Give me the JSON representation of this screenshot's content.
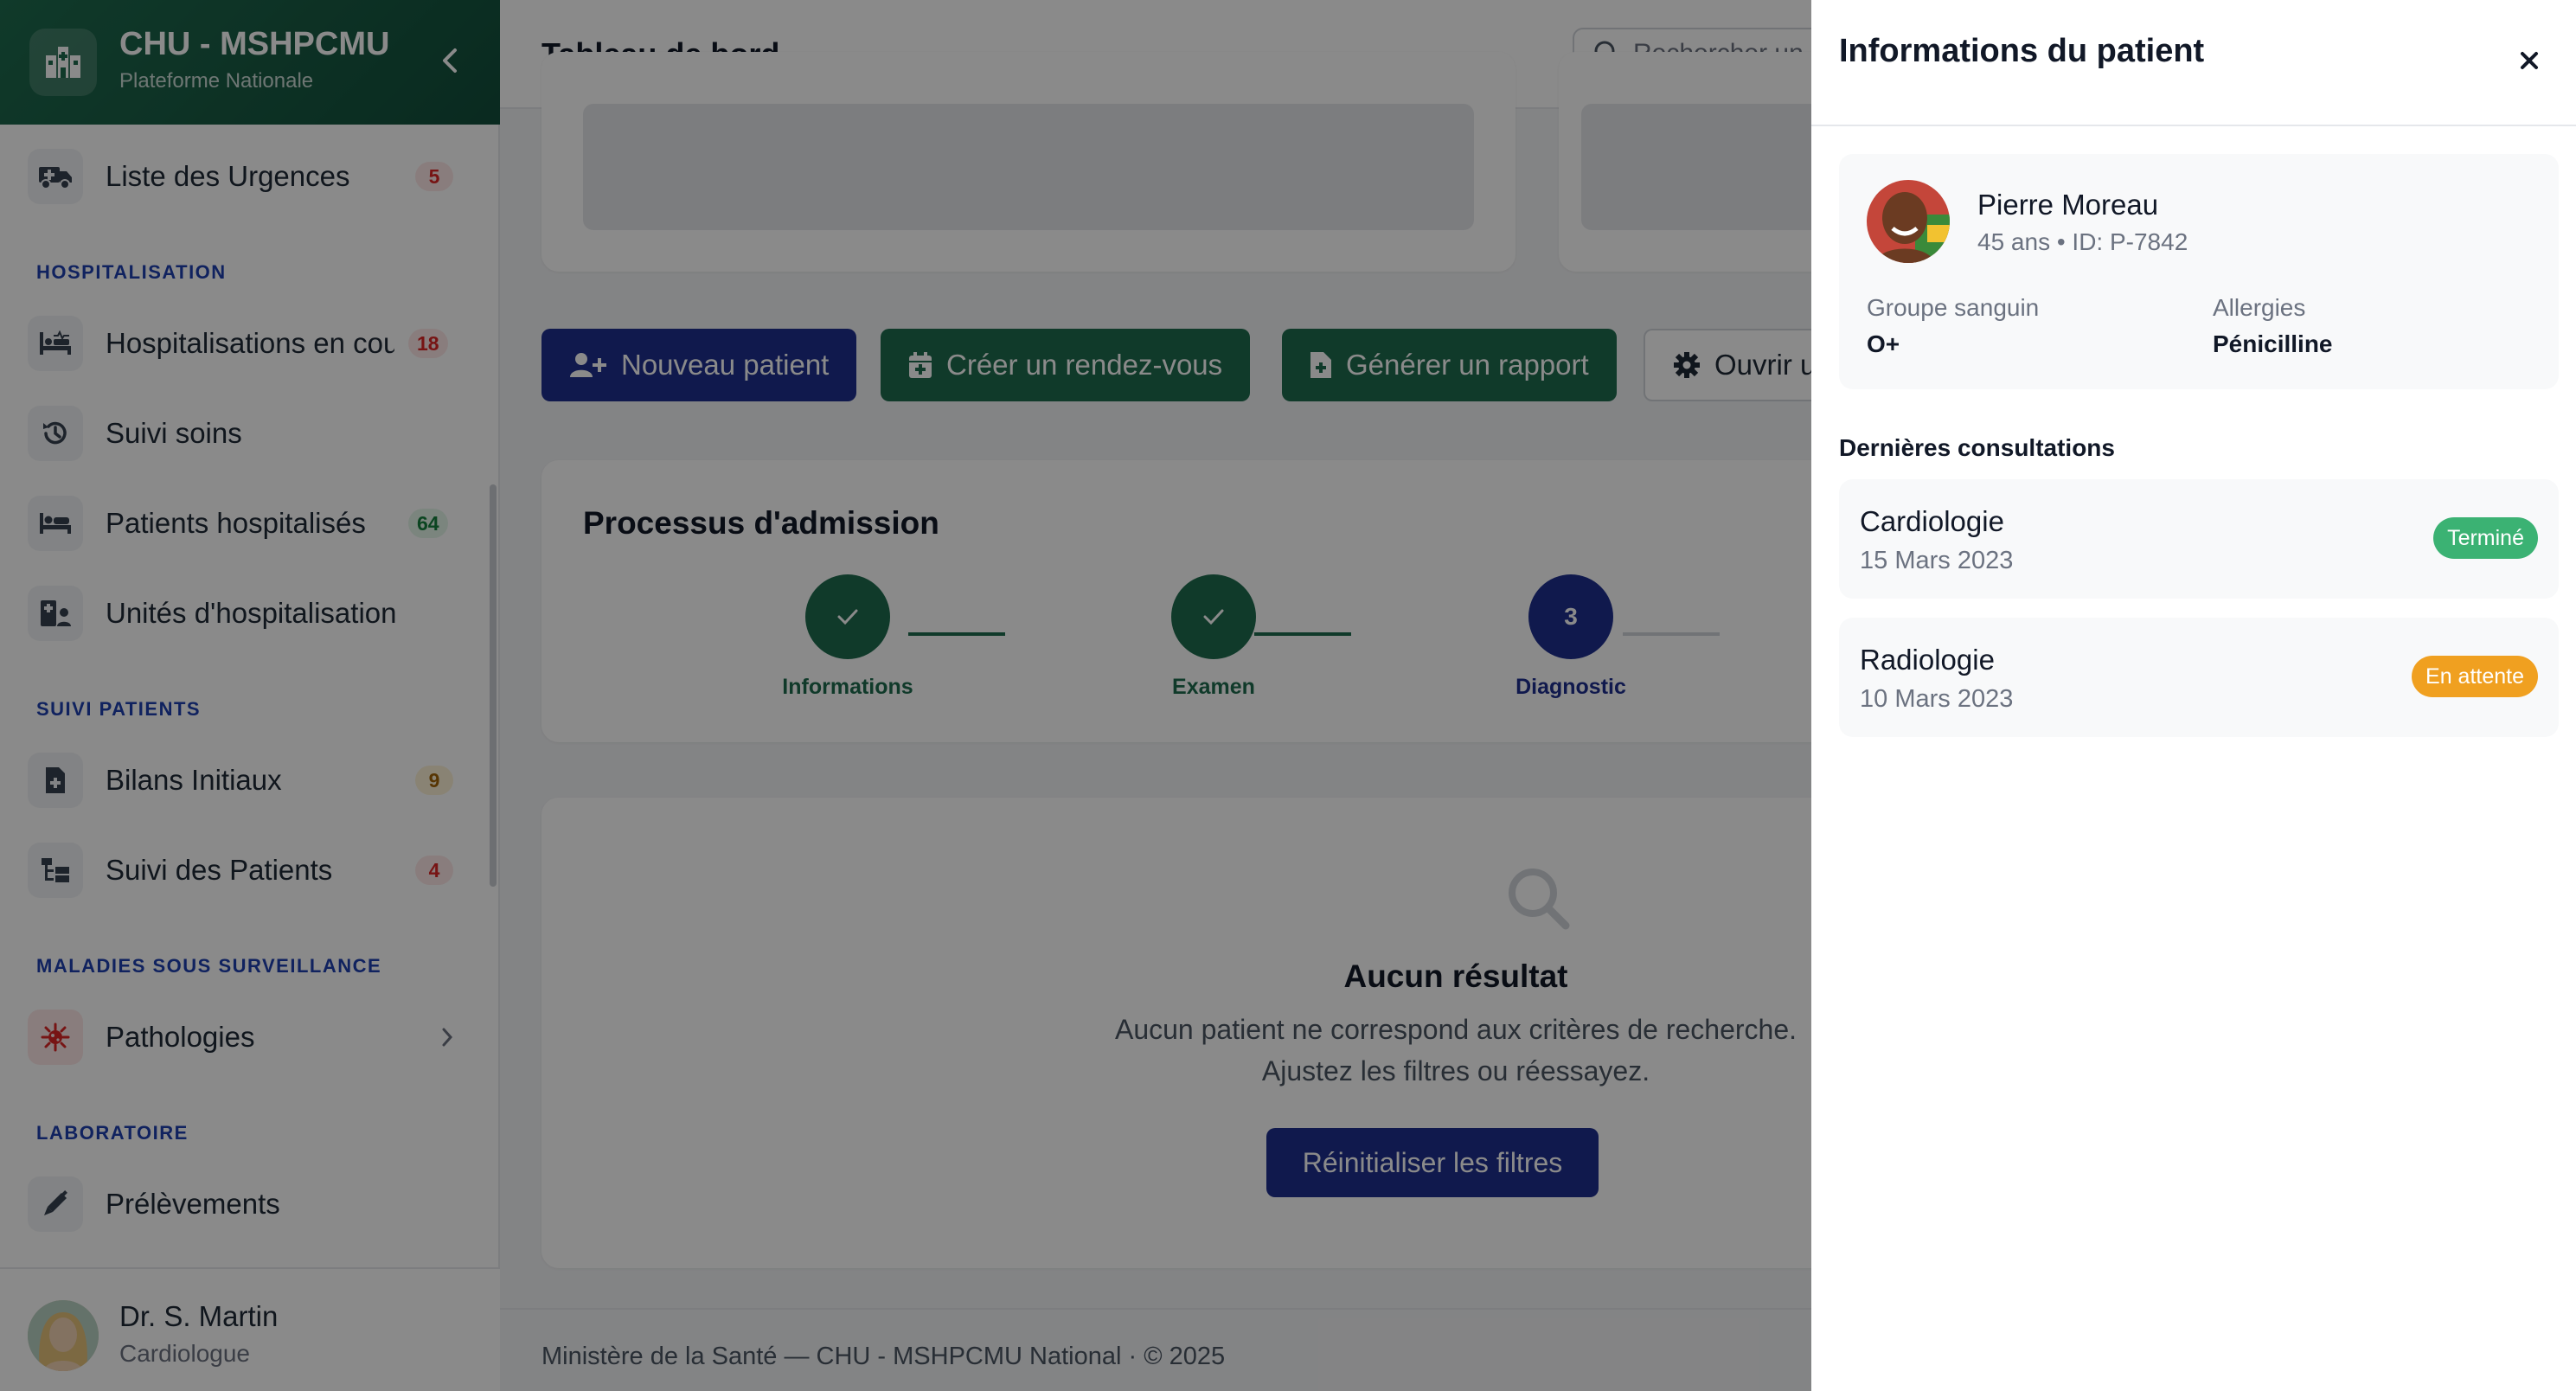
{
  "colors": {
    "brand": "#1e6b4e",
    "primary_blue": "#1e2f8f",
    "accent_green": "#1e6b4e",
    "danger": "#dc2626",
    "success": "#3bb273",
    "warning": "#f0a020"
  },
  "sidebar": {
    "brand_title": "CHU - MSHPCMU",
    "brand_subtitle": "Plateforme Nationale",
    "items": [
      {
        "label": "Liste des Urgences",
        "icon": "ambulance-icon",
        "badge": "5"
      },
      {
        "label": "Hospitalisations en cours",
        "icon": "bed-pulse-icon",
        "badge": "18"
      },
      {
        "label": "Suivi soins",
        "icon": "history-icon",
        "badge": null
      },
      {
        "label": "Patients hospitalisés",
        "icon": "bed-icon",
        "badge": "64"
      },
      {
        "label": "Unités d'hospitalisation",
        "icon": "hospital-user-icon",
        "badge": null
      },
      {
        "label": "Bilans Initiaux",
        "icon": "file-medical-icon",
        "badge": "9"
      },
      {
        "label": "Suivi des Patients",
        "icon": "tree-list-icon",
        "badge": "4"
      },
      {
        "label": "Pathologies",
        "icon": "virus-icon",
        "badge": null
      },
      {
        "label": "Prélèvements",
        "icon": "syringe-icon",
        "badge": null
      }
    ],
    "sections": [
      "HOSPITALISATION",
      "SUIVI PATIENTS",
      "MALADIES SOUS SURVEILLANCE",
      "LABORATOIRE"
    ],
    "user": {
      "name": "Dr. S. Martin",
      "role": "Cardiologue"
    }
  },
  "header": {
    "title": "Tableau de bord",
    "search_placeholder": "Rechercher un patient..."
  },
  "actions": {
    "new_patient": "Nouveau patient",
    "create_appointment": "Créer un rendez-vous",
    "generate_report": "Générer un rapport",
    "open_record": "Ouvrir un dossier"
  },
  "admission": {
    "title": "Processus d'admission",
    "steps": [
      {
        "label": "Informations",
        "state": "done"
      },
      {
        "label": "Examen",
        "state": "done"
      },
      {
        "label": "Diagnostic",
        "number": "3",
        "state": "current"
      }
    ]
  },
  "empty_state": {
    "title": "Aucun résultat",
    "line1": "Aucun patient ne correspond aux critères de recherche.",
    "line2": "Ajustez les filtres ou réessayez.",
    "reset_button": "Réinitialiser les filtres"
  },
  "footer": "Ministère de la Santé — CHU - MSHPCMU National · © 2025",
  "drawer": {
    "title": "Informations du patient",
    "patient": {
      "name": "Pierre Moreau",
      "meta": "45 ans • ID: P-7842",
      "blood_label": "Groupe sanguin",
      "blood_value": "O+",
      "allergy_label": "Allergies",
      "allergy_value": "Pénicilline"
    },
    "consultations_title": "Dernières consultations",
    "consultations": [
      {
        "service": "Cardiologie",
        "date": "15 Mars 2023",
        "status": "Terminé"
      },
      {
        "service": "Radiologie",
        "date": "10 Mars 2023",
        "status": "En attente"
      }
    ]
  }
}
